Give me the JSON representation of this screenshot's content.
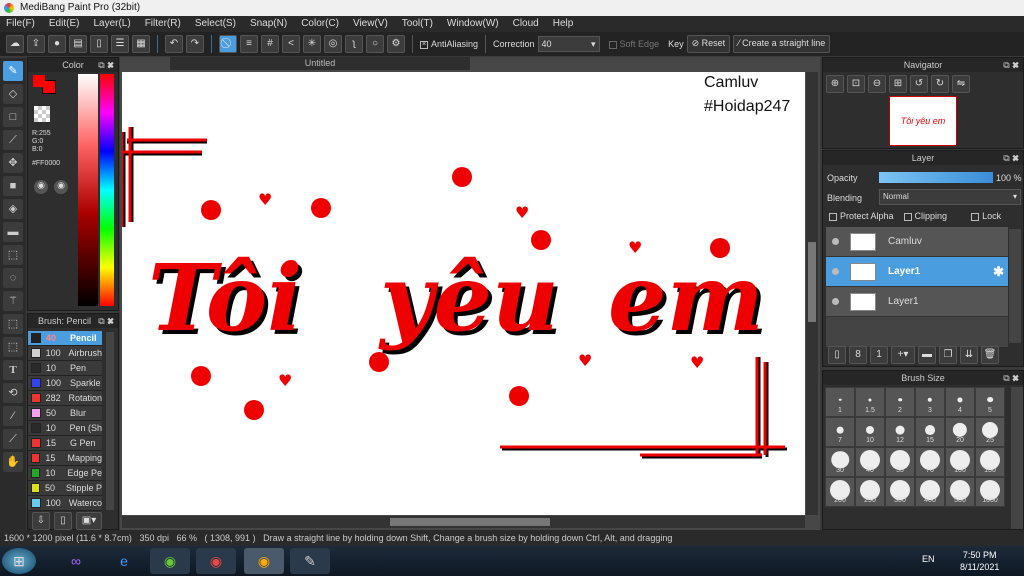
{
  "app": {
    "title": "MediBang Paint Pro (32bit)"
  },
  "menu": [
    "File(F)",
    "Edit(E)",
    "Layer(L)",
    "Filter(R)",
    "Select(S)",
    "Snap(N)",
    "Color(C)",
    "View(V)",
    "Tool(T)",
    "Window(W)",
    "Cloud",
    "Help"
  ],
  "toolbar": {
    "antialiasing": "AntiAliasing",
    "correction_label": "Correction",
    "correction_value": "40",
    "soft_edge": "Soft Edge",
    "key": "Key",
    "reset": "Reset",
    "straight_line": "Create a straight line"
  },
  "color_panel": {
    "title": "Color",
    "r": "R:255",
    "g": "G:0",
    "b": "B:0",
    "hex": "#FF0000",
    "primary": "#ff0000"
  },
  "brush_panel": {
    "title": "Brush: Pencil",
    "items": [
      {
        "size": "40",
        "name": "Pencil",
        "color": "#222222"
      },
      {
        "size": "100",
        "name": "Airbrush",
        "color": "#d0d0d0"
      },
      {
        "size": "10",
        "name": "Pen",
        "color": "#2a2a2a"
      },
      {
        "size": "100",
        "name": "Sparkle",
        "color": "#3344ee"
      },
      {
        "size": "282",
        "name": "Rotation",
        "color": "#ee3333"
      },
      {
        "size": "50",
        "name": "Blur",
        "color": "#f5a0f0"
      },
      {
        "size": "10",
        "name": "Pen (Sh",
        "color": "#2a2a2a"
      },
      {
        "size": "15",
        "name": "G Pen",
        "color": "#ee3333"
      },
      {
        "size": "15",
        "name": "Mapping",
        "color": "#ee3333"
      },
      {
        "size": "10",
        "name": "Edge Pe",
        "color": "#22aa22"
      },
      {
        "size": "50",
        "name": "Stipple P",
        "color": "#dddd22"
      },
      {
        "size": "100",
        "name": "Waterco",
        "color": "#66ccee"
      }
    ]
  },
  "canvas": {
    "tab": "Untitled",
    "watermark1": "Camluv",
    "watermark2": "#Hoidap247",
    "text_words": [
      "Tôi",
      "yêu",
      "em"
    ]
  },
  "navigator": {
    "title": "Navigator"
  },
  "layer_panel": {
    "title": "Layer",
    "opacity_label": "Opacity",
    "opacity_value": "100 %",
    "opacity": 1.0,
    "blending_label": "Blending",
    "blending_value": "Normal",
    "protect_alpha": "Protect Alpha",
    "clipping": "Clipping",
    "lock": "Lock",
    "layers": [
      {
        "name": "Camluv"
      },
      {
        "name": "Layer1",
        "selected": true
      },
      {
        "name": "Layer1"
      }
    ]
  },
  "brush_size": {
    "title": "Brush Size",
    "sizes": [
      "1",
      "1.5",
      "2",
      "3",
      "4",
      "5",
      "7",
      "10",
      "12",
      "15",
      "20",
      "25",
      "30",
      "40",
      "50",
      "70",
      "100",
      "150",
      "200",
      "250",
      "300",
      "400",
      "500",
      "1000"
    ]
  },
  "status": {
    "dimensions": "1600 * 1200 pixel",
    "physical": "(11.6 * 8.7cm)",
    "dpi": "350 dpi",
    "zoom": "66 %",
    "coords": "( 1308, 991 )",
    "hint": "Draw a straight line by holding down Shift, Change a brush size by holding down Ctrl, Alt, and dragging"
  },
  "taskbar": {
    "lang": "EN",
    "time": "7:50 PM",
    "date": "8/11/2021"
  }
}
